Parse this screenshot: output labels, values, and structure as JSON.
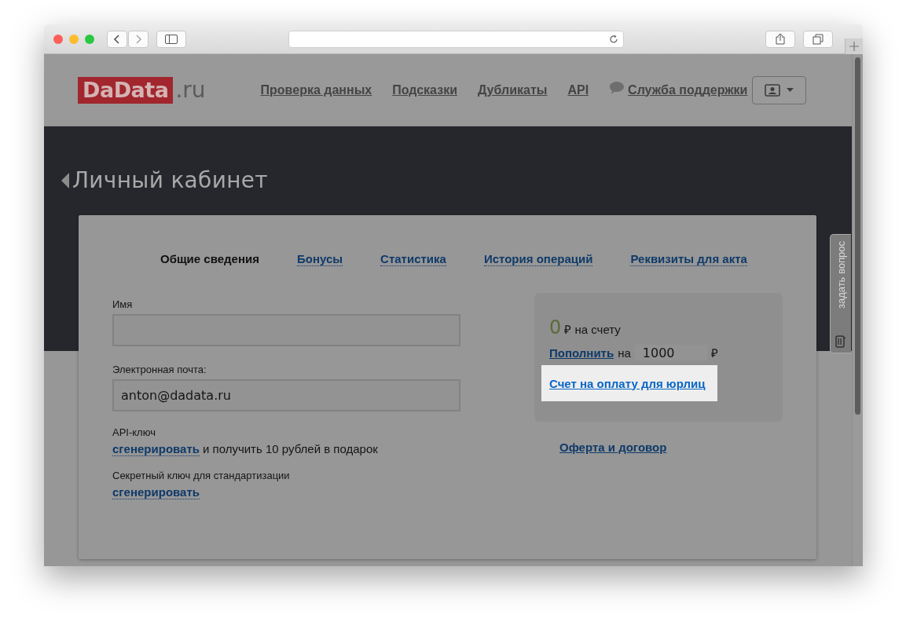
{
  "logo": {
    "brand": "DaData",
    "suffix": ".ru"
  },
  "nav": [
    {
      "label": "Проверка данных",
      "kind": "link"
    },
    {
      "label": "Подсказки",
      "kind": "link"
    },
    {
      "label": "Дубликаты",
      "kind": "link"
    },
    {
      "label": "API",
      "kind": "link"
    },
    {
      "label": "Служба поддержки",
      "kind": "support"
    }
  ],
  "page_title": "Личный кабинет",
  "tabs": [
    {
      "label": "Общие сведения",
      "selected": true
    },
    {
      "label": "Бонусы",
      "selected": false
    },
    {
      "label": "Статистика",
      "selected": false
    },
    {
      "label": "История операций",
      "selected": false
    },
    {
      "label": "Реквизиты для акта",
      "selected": false
    }
  ],
  "fields": [
    {
      "label": "Имя"
    },
    {
      "label": "Электронная почта:",
      "value": "anton@dadata.ru"
    }
  ],
  "keys": [
    {
      "label": "API-ключ",
      "link": "сгенерировать",
      "note": "и получить 10 рублей в подарок"
    },
    {
      "label": "Секретный ключ для стандартизации",
      "link": "сгенерировать"
    }
  ],
  "balance": {
    "amount": "0",
    "text": "₽ на счету",
    "topup_link": "Пополнить",
    "topup_on": "на",
    "topup_value": "1000",
    "currency": "₽",
    "invoice_link": "Счет на оплату для юрлиц"
  },
  "offer_link": "Оферта и договор",
  "feedback_tab": "задать вопрос"
}
